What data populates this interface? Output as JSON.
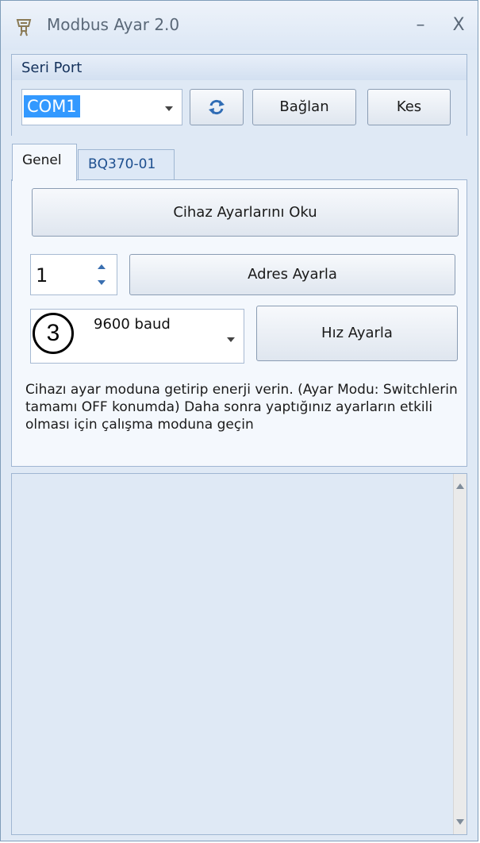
{
  "window": {
    "title": "Modbus Ayar 2.0",
    "minimize_glyph": "–",
    "close_glyph": "X"
  },
  "serial_port": {
    "group_label": "Seri Port",
    "port_value": "COM1",
    "connect_label": "Bağlan",
    "disconnect_label": "Kes",
    "refresh_icon": "refresh-icon"
  },
  "tabs": [
    {
      "label": "Genel",
      "active": true
    },
    {
      "label": "BQ370-01",
      "active": false
    }
  ],
  "general": {
    "read_button_label": "Cihaz Ayarlarını Oku",
    "address_value": "1",
    "set_address_label": "Adres Ayarla",
    "annotation_number": "3",
    "baud_value": "9600 baud",
    "set_speed_label": "Hız Ayarla",
    "info_text": "Cihazı ayar moduna getirip enerji verin. (Ayar Modu: Switchlerin  tamamı OFF konumda) Daha sonra yaptığınız ayarların etkili olması için çalışma moduna geçin"
  },
  "colors": {
    "window_bg": "#dfe9f5",
    "selection": "#3399ff",
    "tab_link": "#1d4f8f"
  }
}
